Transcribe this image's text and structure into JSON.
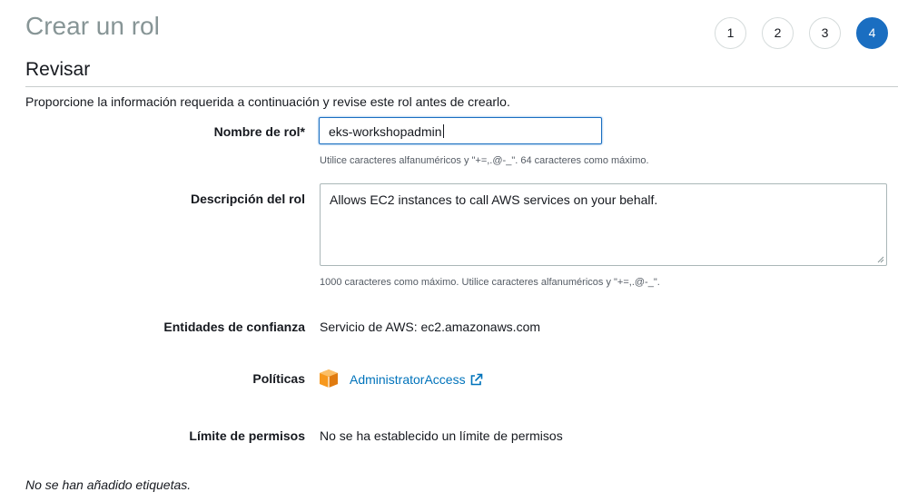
{
  "header": {
    "title": "Crear un rol",
    "steps": [
      "1",
      "2",
      "3",
      "4"
    ],
    "active_step": "4"
  },
  "section": {
    "title": "Revisar",
    "intro": "Proporcione la información requerida a continuación y revise este rol antes de crearlo."
  },
  "role_name": {
    "label": "Nombre de rol*",
    "value": "eks-workshopadmin",
    "hint": "Utilice caracteres alfanuméricos y \"+=,.@-_\". 64 caracteres como máximo."
  },
  "description": {
    "label": "Descripción del rol",
    "value": "Allows EC2 instances to call AWS services on your behalf.",
    "hint": "1000 caracteres como máximo. Utilice caracteres alfanuméricos y \"+=,.@-_\"."
  },
  "trusted_entities": {
    "label": "Entidades de confianza",
    "value": "Servicio de AWS: ec2.amazonaws.com"
  },
  "policies": {
    "label": "Políticas",
    "items": [
      {
        "name": "AdministratorAccess",
        "icon": "aws-managed-policy-icon"
      }
    ]
  },
  "permissions_boundary": {
    "label": "Límite de permisos",
    "value": "No se ha establecido un límite de permisos"
  },
  "tags": {
    "note": "No se han añadido etiquetas."
  },
  "colors": {
    "accent": "#1a6ec1",
    "link": "#0073bb",
    "policy_icon": "#f7981d"
  }
}
